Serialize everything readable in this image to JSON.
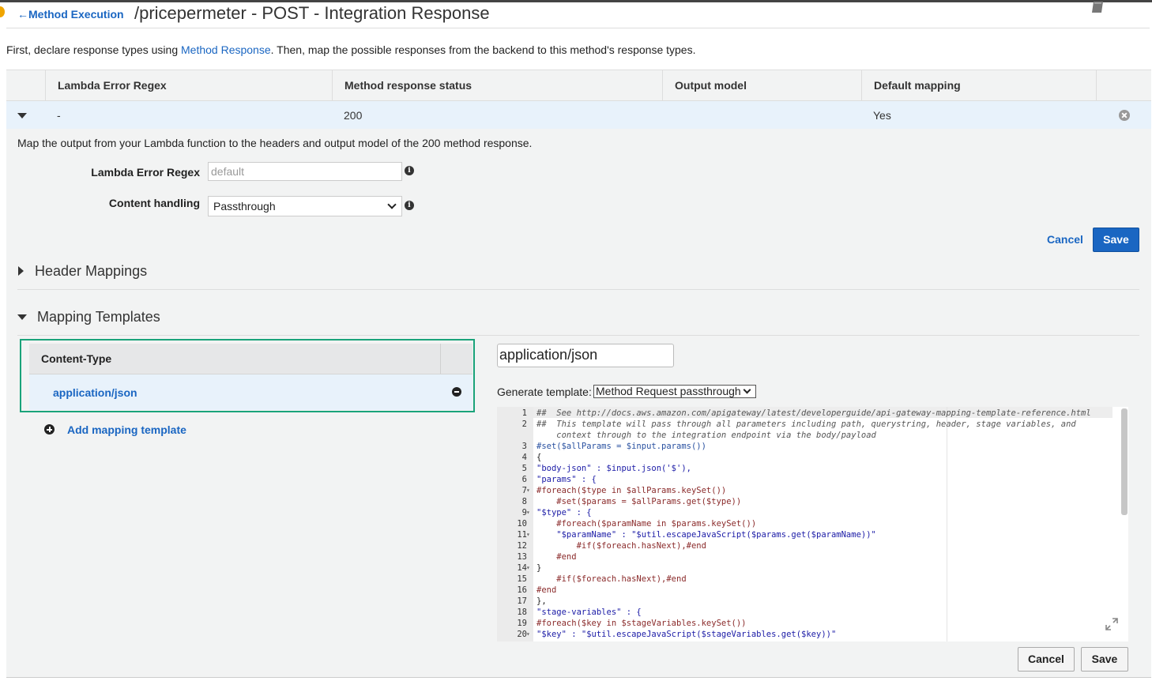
{
  "header": {
    "back_label": "Method Execution",
    "title": "/pricepermeter - POST - Integration Response"
  },
  "intro": {
    "before": "First, declare response types using ",
    "link": "Method Response",
    "after": ". Then, map the possible responses from the backend to this method's response types."
  },
  "response_table": {
    "columns": [
      "Lambda Error Regex",
      "Method response status",
      "Output model",
      "Default mapping"
    ],
    "rows": [
      {
        "regex": "-",
        "status": "200",
        "model": "",
        "default": "Yes"
      }
    ]
  },
  "detail": {
    "description": "Map the output from your Lambda function to the headers and output model of the 200 method response.",
    "regex_label": "Lambda Error Regex",
    "regex_placeholder": "default",
    "content_handling_label": "Content handling",
    "content_handling_value": "Passthrough",
    "cancel_label": "Cancel",
    "save_label": "Save"
  },
  "sections": {
    "header_mappings": "Header Mappings",
    "mapping_templates": "Mapping Templates"
  },
  "content_types": {
    "header": "Content-Type",
    "items": [
      "application/json"
    ],
    "add_label": "Add mapping template"
  },
  "template_editor": {
    "content_type_value": "application/json",
    "generate_label": "Generate template:",
    "generate_value": "Method Request passthrough",
    "lines": [
      {
        "n": "1",
        "fold": "",
        "text": "##  See http://docs.aws.amazon.com/apigateway/latest/developerguide/api-gateway-mapping-template-reference.html",
        "cls": "cmt"
      },
      {
        "n": "2",
        "fold": "",
        "text": "##  This template will pass through all parameters including path, querystring, header, stage variables, and",
        "cls": "cmt"
      },
      {
        "n": "",
        "fold": "",
        "text": "    context through to the integration endpoint via the body/payload",
        "cls": "cmt"
      },
      {
        "n": "3",
        "fold": "",
        "text": "#set($allParams = $input.params())",
        "cls": "var"
      },
      {
        "n": "4",
        "fold": "",
        "text": "{",
        "cls": ""
      },
      {
        "n": "5",
        "fold": "",
        "text": "\"body-json\" : $input.json('$'),",
        "cls": "str"
      },
      {
        "n": "6",
        "fold": "",
        "text": "\"params\" : {",
        "cls": "str"
      },
      {
        "n": "7",
        "fold": "▾",
        "text": "#foreach($type in $allParams.keySet())",
        "cls": "kw"
      },
      {
        "n": "8",
        "fold": "",
        "text": "    #set($params = $allParams.get($type))",
        "cls": "kw"
      },
      {
        "n": "9",
        "fold": "▾",
        "text": "\"$type\" : {",
        "cls": "str"
      },
      {
        "n": "10",
        "fold": "",
        "text": "    #foreach($paramName in $params.keySet())",
        "cls": "kw"
      },
      {
        "n": "11",
        "fold": "▾",
        "text": "    \"$paramName\" : \"$util.escapeJavaScript($params.get($paramName))\"",
        "cls": "str"
      },
      {
        "n": "12",
        "fold": "",
        "text": "        #if($foreach.hasNext),#end",
        "cls": "kw"
      },
      {
        "n": "13",
        "fold": "",
        "text": "    #end",
        "cls": "kw"
      },
      {
        "n": "14",
        "fold": "▾",
        "text": "}",
        "cls": ""
      },
      {
        "n": "15",
        "fold": "",
        "text": "    #if($foreach.hasNext),#end",
        "cls": "kw"
      },
      {
        "n": "16",
        "fold": "",
        "text": "#end",
        "cls": "kw"
      },
      {
        "n": "17",
        "fold": "",
        "text": "},",
        "cls": ""
      },
      {
        "n": "18",
        "fold": "",
        "text": "\"stage-variables\" : {",
        "cls": "str"
      },
      {
        "n": "19",
        "fold": "",
        "text": "#foreach($key in $stageVariables.keySet())",
        "cls": "kw"
      },
      {
        "n": "20",
        "fold": "▾",
        "text": "\"$key\" : \"$util.escapeJavaScript($stageVariables.get($key))\"",
        "cls": "str"
      }
    ],
    "cancel_label": "Cancel",
    "save_label": "Save"
  },
  "colors": {
    "link": "#1a66c2",
    "primary_button": "#1a66c2",
    "highlight_border": "#1aa37a",
    "selected_row": "#e8f2fb"
  }
}
